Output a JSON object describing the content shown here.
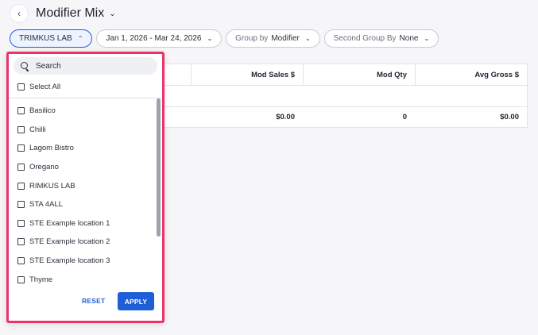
{
  "header": {
    "back_icon": "chevron-left-icon",
    "title": "Modifier Mix"
  },
  "filters": {
    "location": "TRIMKUS LAB",
    "date_range": "Jan 1, 2026 - Mar 24, 2026",
    "group_by_label": "Group by",
    "group_by_value": "Modifier",
    "second_group_by_label": "Second Group By",
    "second_group_by_value": "None"
  },
  "table": {
    "columns": [
      "",
      "Mod Sales $",
      "Mod Qty",
      "Avg Gross $"
    ],
    "totals": [
      "",
      "$0.00",
      "0",
      "$0.00"
    ]
  },
  "dropdown": {
    "search_placeholder": "Search",
    "select_all": "Select All",
    "options": [
      "Basilico",
      "Chilli",
      "Lagom Bistro",
      "Oregano",
      "RIMKUS LAB",
      "STA 4ALL",
      "STE Example location 1",
      "STE Example location 2",
      "STE Example location 3",
      "Thyme"
    ],
    "reset_label": "RESET",
    "apply_label": "APPLY",
    "highlight_color": "#e8346b"
  },
  "colors": {
    "accent": "#1e5fd8"
  }
}
